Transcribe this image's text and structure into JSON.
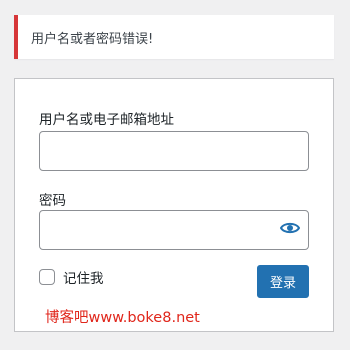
{
  "error": {
    "message": "用户名或者密码错误!"
  },
  "form": {
    "username_label": "用户名或电子邮箱地址",
    "username_value": "",
    "password_label": "密码",
    "password_value": "",
    "show_password_icon": "eye-icon",
    "remember_label": "记住我",
    "remember_checked": false,
    "login_label": "登录"
  },
  "watermark": {
    "text": "博客吧www.boke8.net"
  },
  "colors": {
    "error_accent": "#d63638",
    "primary": "#2271b1",
    "watermark": "#e0261b"
  }
}
